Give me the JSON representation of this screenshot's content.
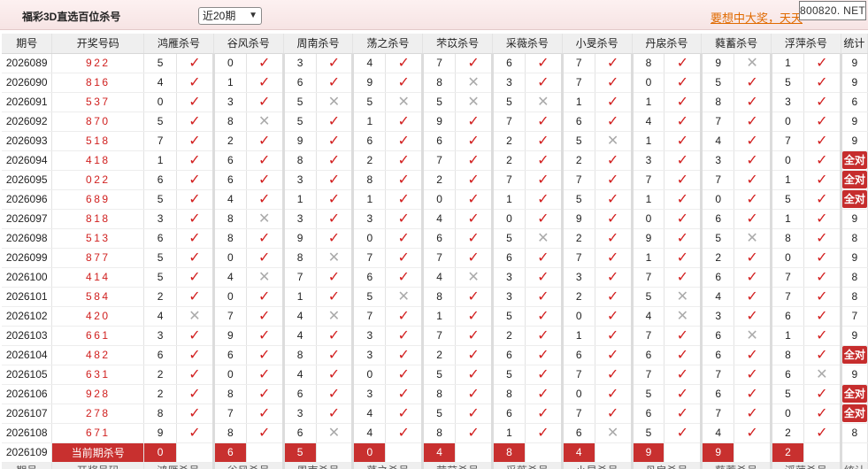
{
  "app_title": "福彩3D直选百位杀号",
  "period_selector": {
    "selected": "近20期"
  },
  "promo_link": "要想中大奖，天天",
  "watermark": "800820. NET",
  "colors": {
    "accent_red": "#d21f1f",
    "badge_bg": "#c62d2d",
    "miss_gray": "#aaaaaa"
  },
  "headers": {
    "issue": "期号",
    "draw": "开奖号码",
    "methods": [
      "鸿雁杀号",
      "谷风杀号",
      "周南杀号",
      "荡之杀号",
      "芣苡杀号",
      "采薇杀号",
      "小旻杀号",
      "丹扆杀号",
      "蕤蓄杀号",
      "浮萍杀号"
    ],
    "stats": "统计"
  },
  "rows": [
    {
      "issue": "2026089",
      "draw": "922",
      "kills": [
        5,
        0,
        3,
        4,
        7,
        6,
        7,
        8,
        9,
        1
      ],
      "hits": [
        1,
        1,
        1,
        1,
        1,
        1,
        1,
        1,
        0,
        1
      ],
      "stat": "9"
    },
    {
      "issue": "2026090",
      "draw": "816",
      "kills": [
        4,
        1,
        6,
        9,
        8,
        3,
        7,
        0,
        5,
        5
      ],
      "hits": [
        1,
        1,
        1,
        1,
        0,
        1,
        1,
        1,
        1,
        1
      ],
      "stat": "9"
    },
    {
      "issue": "2026091",
      "draw": "537",
      "kills": [
        0,
        3,
        5,
        5,
        5,
        5,
        1,
        1,
        8,
        3
      ],
      "hits": [
        1,
        1,
        0,
        0,
        0,
        0,
        1,
        1,
        1,
        1
      ],
      "stat": "6"
    },
    {
      "issue": "2026092",
      "draw": "870",
      "kills": [
        5,
        8,
        5,
        1,
        9,
        7,
        6,
        4,
        7,
        0
      ],
      "hits": [
        1,
        0,
        1,
        1,
        1,
        1,
        1,
        1,
        1,
        1
      ],
      "stat": "9"
    },
    {
      "issue": "2026093",
      "draw": "518",
      "kills": [
        7,
        2,
        9,
        6,
        6,
        2,
        5,
        1,
        4,
        7
      ],
      "hits": [
        1,
        1,
        1,
        1,
        1,
        1,
        0,
        1,
        1,
        1
      ],
      "stat": "9"
    },
    {
      "issue": "2026094",
      "draw": "418",
      "kills": [
        1,
        6,
        8,
        2,
        7,
        2,
        2,
        3,
        3,
        0
      ],
      "hits": [
        1,
        1,
        1,
        1,
        1,
        1,
        1,
        1,
        1,
        1
      ],
      "stat": "全对"
    },
    {
      "issue": "2026095",
      "draw": "022",
      "kills": [
        6,
        6,
        3,
        8,
        2,
        7,
        7,
        7,
        7,
        1
      ],
      "hits": [
        1,
        1,
        1,
        1,
        1,
        1,
        1,
        1,
        1,
        1
      ],
      "stat": "全对"
    },
    {
      "issue": "2026096",
      "draw": "689",
      "kills": [
        5,
        4,
        1,
        1,
        0,
        1,
        5,
        1,
        0,
        5
      ],
      "hits": [
        1,
        1,
        1,
        1,
        1,
        1,
        1,
        1,
        1,
        1
      ],
      "stat": "全对"
    },
    {
      "issue": "2026097",
      "draw": "818",
      "kills": [
        3,
        8,
        3,
        3,
        4,
        0,
        9,
        0,
        6,
        1
      ],
      "hits": [
        1,
        0,
        1,
        1,
        1,
        1,
        1,
        1,
        1,
        1
      ],
      "stat": "9"
    },
    {
      "issue": "2026098",
      "draw": "513",
      "kills": [
        6,
        8,
        9,
        0,
        6,
        5,
        2,
        9,
        5,
        8
      ],
      "hits": [
        1,
        1,
        1,
        1,
        1,
        0,
        1,
        1,
        0,
        1
      ],
      "stat": "8"
    },
    {
      "issue": "2026099",
      "draw": "877",
      "kills": [
        5,
        0,
        8,
        7,
        7,
        6,
        7,
        1,
        2,
        0
      ],
      "hits": [
        1,
        1,
        0,
        1,
        1,
        1,
        1,
        1,
        1,
        1
      ],
      "stat": "9"
    },
    {
      "issue": "2026100",
      "draw": "414",
      "kills": [
        5,
        4,
        7,
        6,
        4,
        3,
        3,
        7,
        6,
        7
      ],
      "hits": [
        1,
        0,
        1,
        1,
        0,
        1,
        1,
        1,
        1,
        1
      ],
      "stat": "8"
    },
    {
      "issue": "2026101",
      "draw": "584",
      "kills": [
        2,
        0,
        1,
        5,
        8,
        3,
        2,
        5,
        4,
        7
      ],
      "hits": [
        1,
        1,
        1,
        0,
        1,
        1,
        1,
        0,
        1,
        1
      ],
      "stat": "8"
    },
    {
      "issue": "2026102",
      "draw": "420",
      "kills": [
        4,
        7,
        4,
        7,
        1,
        5,
        0,
        4,
        3,
        6
      ],
      "hits": [
        0,
        1,
        0,
        1,
        1,
        1,
        1,
        0,
        1,
        1
      ],
      "stat": "7"
    },
    {
      "issue": "2026103",
      "draw": "661",
      "kills": [
        3,
        9,
        4,
        3,
        7,
        2,
        1,
        7,
        6,
        1
      ],
      "hits": [
        1,
        1,
        1,
        1,
        1,
        1,
        1,
        1,
        0,
        1
      ],
      "stat": "9"
    },
    {
      "issue": "2026104",
      "draw": "482",
      "kills": [
        6,
        6,
        8,
        3,
        2,
        6,
        6,
        6,
        6,
        8
      ],
      "hits": [
        1,
        1,
        1,
        1,
        1,
        1,
        1,
        1,
        1,
        1
      ],
      "stat": "全对"
    },
    {
      "issue": "2026105",
      "draw": "631",
      "kills": [
        2,
        0,
        4,
        0,
        5,
        5,
        7,
        7,
        7,
        6
      ],
      "hits": [
        1,
        1,
        1,
        1,
        1,
        1,
        1,
        1,
        1,
        0
      ],
      "stat": "9"
    },
    {
      "issue": "2026106",
      "draw": "928",
      "kills": [
        2,
        8,
        6,
        3,
        8,
        8,
        0,
        5,
        6,
        5
      ],
      "hits": [
        1,
        1,
        1,
        1,
        1,
        1,
        1,
        1,
        1,
        1
      ],
      "stat": "全对"
    },
    {
      "issue": "2026107",
      "draw": "278",
      "kills": [
        8,
        7,
        3,
        4,
        5,
        6,
        7,
        6,
        7,
        0
      ],
      "hits": [
        1,
        1,
        1,
        1,
        1,
        1,
        1,
        1,
        1,
        1
      ],
      "stat": "全对"
    },
    {
      "issue": "2026108",
      "draw": "671",
      "kills": [
        9,
        8,
        6,
        4,
        8,
        1,
        6,
        5,
        4,
        2
      ],
      "hits": [
        1,
        1,
        0,
        1,
        1,
        1,
        0,
        1,
        1,
        1
      ],
      "stat": "8"
    }
  ],
  "current": {
    "issue": "2026109",
    "label": "当前期杀号",
    "kills": [
      0,
      6,
      5,
      0,
      4,
      8,
      4,
      9,
      9,
      2
    ]
  },
  "marks": {
    "hit": "✓",
    "miss": "✕"
  }
}
